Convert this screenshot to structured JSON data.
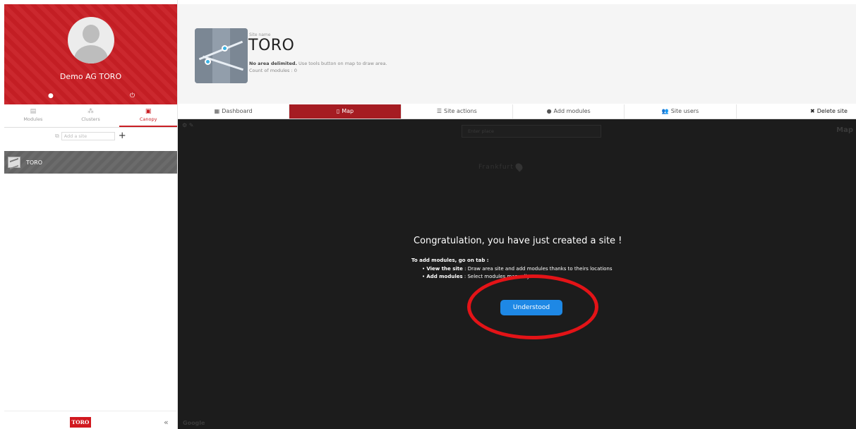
{
  "profile": {
    "name": "Demo AG TORO"
  },
  "side_tabs": [
    {
      "label": "Modules",
      "icon": "module-icon"
    },
    {
      "label": "Clusters",
      "icon": "cluster-icon"
    },
    {
      "label": "Canopy",
      "icon": "canopy-icon"
    }
  ],
  "site_search": {
    "placeholder": "Add a site",
    "add_label": "+"
  },
  "sites": [
    {
      "label": "TORO"
    }
  ],
  "footer": {
    "logo_text": "TORO",
    "collapse_label": "«"
  },
  "header": {
    "caption": "Site name",
    "title": "TORO",
    "desc_bold": "No area delimited.",
    "desc_rest": " Use tools button on map to draw area.",
    "count": "Count of modules : 0"
  },
  "tabs": [
    {
      "label": "Dashboard",
      "icon": "▦"
    },
    {
      "label": "Map",
      "icon": "▯"
    },
    {
      "label": "Site actions",
      "icon": "☰"
    },
    {
      "label": "Add modules",
      "icon": "●"
    },
    {
      "label": "Site users",
      "icon": "👥"
    },
    {
      "label": "Delete site",
      "icon": "✖"
    }
  ],
  "map": {
    "search_placeholder": "Enter place",
    "type_label": "Map",
    "place_label": "Frankfurt",
    "google_label": "Google"
  },
  "modal": {
    "title": "Congratulation, you have just created a site !",
    "intro": "To add modules, go on tab :",
    "item1_bold": "View the site",
    "item1_rest": " : Draw area site and add modules thanks to theirs locations",
    "item2_bold": "Add modules",
    "item2_rest": " : Select modules manually",
    "button": "Understood"
  },
  "colors": {
    "brand_red": "#c91f25",
    "tab_active": "#a51c22",
    "button_blue": "#1e88e5",
    "highlight_ring": "#e31317"
  }
}
